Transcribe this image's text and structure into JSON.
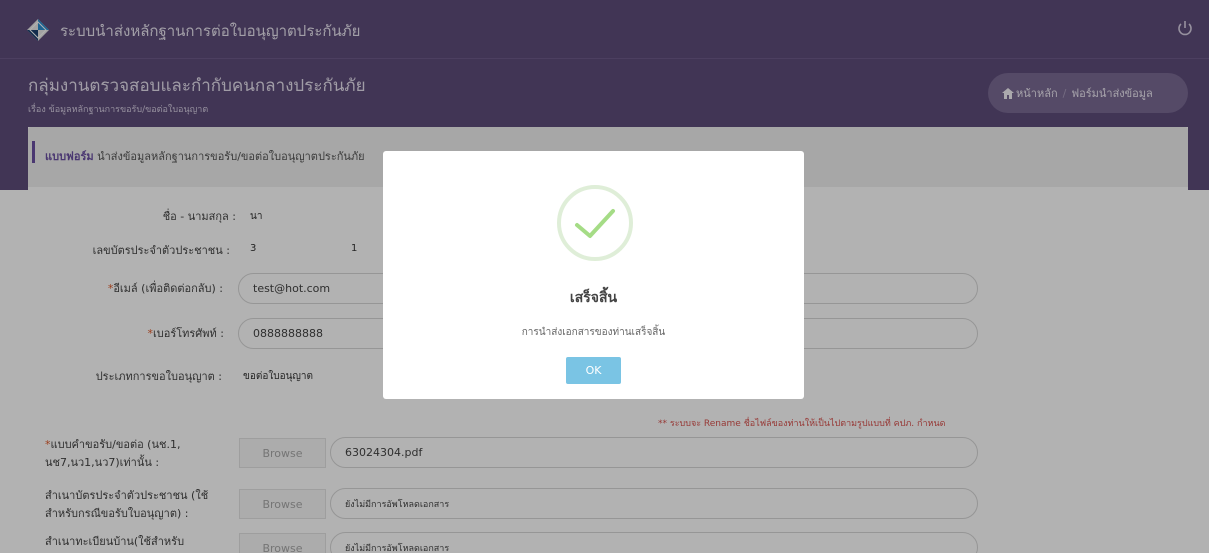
{
  "app": {
    "title": "ระบบนำส่งหลักฐานการต่อใบอนุญาตประกันภัย",
    "logo_icon": "diamond-logo-icon",
    "power_icon": "power-icon"
  },
  "header": {
    "group_title": "กลุ่มงานตรวจสอบและกำกับคนกลางประกันภัย",
    "subject": "เรื่อง ข้อมูลหลักฐานการขอรับ/ขอต่อใบอนุญาต",
    "breadcrumb": {
      "home": "หน้าหลัก",
      "separator": "/",
      "current": "ฟอร์มนำส่งข้อมูล"
    }
  },
  "form": {
    "title_keyword": "แบบฟอร์ม",
    "title_text": "นำส่งข้อมูลหลักฐานการขอรับ/ขอต่อใบอนุญาตประกันภัย",
    "name_label": "ชื่อ - นามสกุล :",
    "name_value": "นา",
    "id_label": "เลขบัตรประจำตัวประชาชน :",
    "id_value_a": "3",
    "id_value_b": "1",
    "email_label": "อีเมล์ (เพื่อติดต่อกลับ) :",
    "email_value": "test@hot.com",
    "phone_label": "เบอร์โทรศัพท์ :",
    "phone_value": "0888888888",
    "license_type_label": "ประเภทการขอใบอนุญาต :",
    "license_type_value": "ขอต่อใบอนุญาต",
    "required_mark": "*",
    "notice": "** ระบบจะ Rename ชื่อไฟล์ของท่านให้เป็นไปตามรูปแบบที่ คปภ. กำหนด",
    "uploads": [
      {
        "label": "แบบคำขอรับ/ขอต่อ (นช.1, นช7,นว1,นว7)เท่านั้น :",
        "required": true,
        "button": "Browse",
        "file": "63024304.pdf"
      },
      {
        "label": "สำเนาบัตรประจำตัวประชาชน (ใช้สำหรับกรณีขอรับใบอนุญาต) :",
        "required": false,
        "button": "Browse",
        "file": "ยังไม่มีการอัพโหลดเอกสาร"
      },
      {
        "label": "สำเนาทะเบียนบ้าน(ใช้สำหรับ",
        "required": false,
        "button": "Browse",
        "file": "ยังไม่มีการอัพโหลดเอกสาร"
      }
    ]
  },
  "modal": {
    "icon": "success-check-icon",
    "title": "เสร็จสิ้น",
    "message": "การนำส่งเอกสารของท่านเสร็จสิ้น",
    "ok_label": "OK"
  },
  "colors": {
    "header": "#5d4c7a",
    "accent": "#6b4fa3",
    "success": "#a5dc86",
    "ok_button": "#7ac4e4",
    "notice": "#d9534f"
  }
}
